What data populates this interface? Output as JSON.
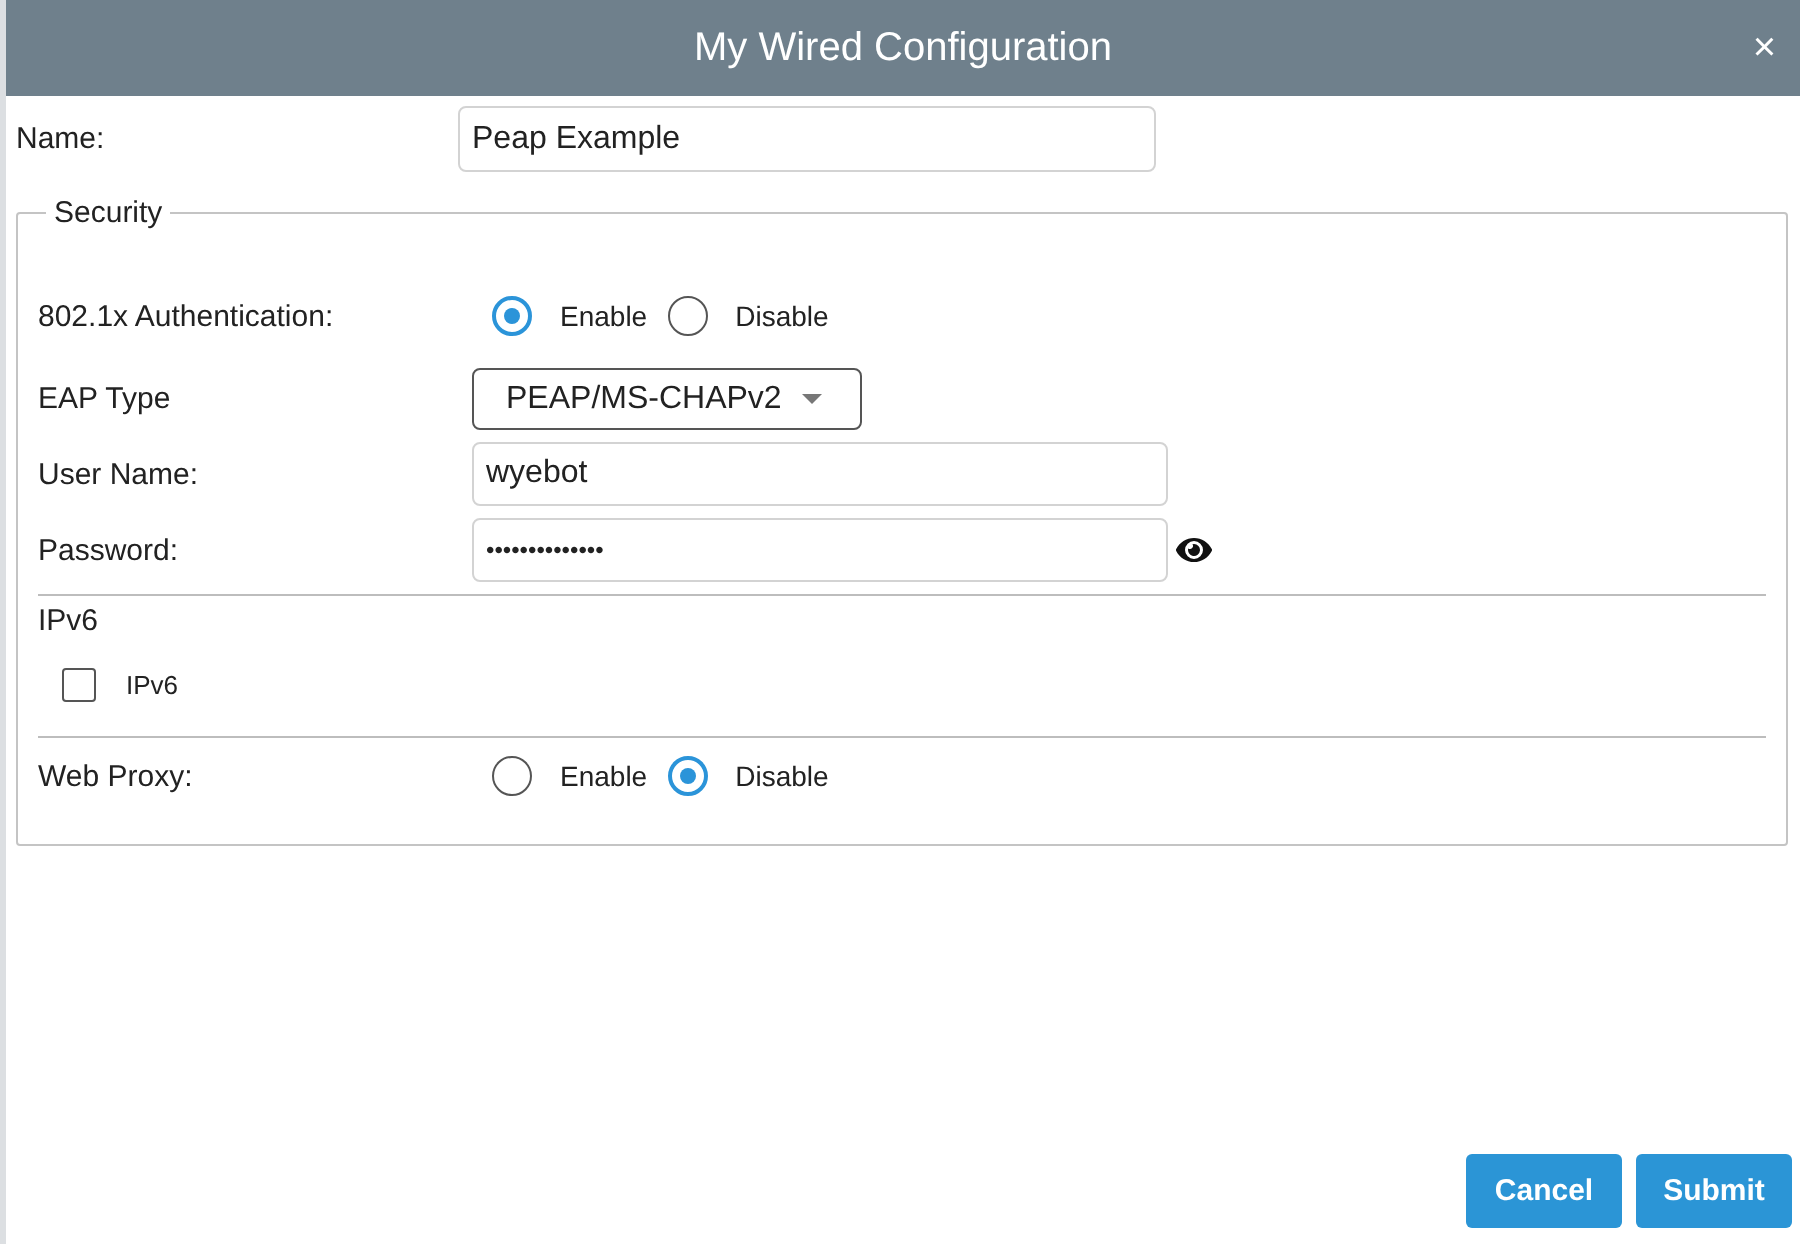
{
  "dialog": {
    "title": "My Wired Configuration",
    "close": "×"
  },
  "name_field": {
    "label": "Name:",
    "value": "Peap Example"
  },
  "security": {
    "legend": "Security",
    "authentication": {
      "label": "802.1x Authentication:",
      "options": [
        {
          "label": "Enable",
          "selected": true
        },
        {
          "label": "Disable",
          "selected": false
        }
      ]
    },
    "eap_type": {
      "label": "EAP Type",
      "value": "PEAP/MS-CHAPv2"
    },
    "user_name": {
      "label": "User Name:",
      "value": "wyebot"
    },
    "password": {
      "label": "Password:",
      "value": "••••••••••••••"
    },
    "ipv6": {
      "heading": "IPv6",
      "checkbox": {
        "label": "IPv6",
        "checked": false
      }
    },
    "web_proxy": {
      "label": "Web Proxy:",
      "options": [
        {
          "label": "Enable",
          "selected": false
        },
        {
          "label": "Disable",
          "selected": true
        }
      ]
    }
  },
  "buttons": [
    {
      "label": "Cancel"
    },
    {
      "label": "Submit"
    }
  ]
}
